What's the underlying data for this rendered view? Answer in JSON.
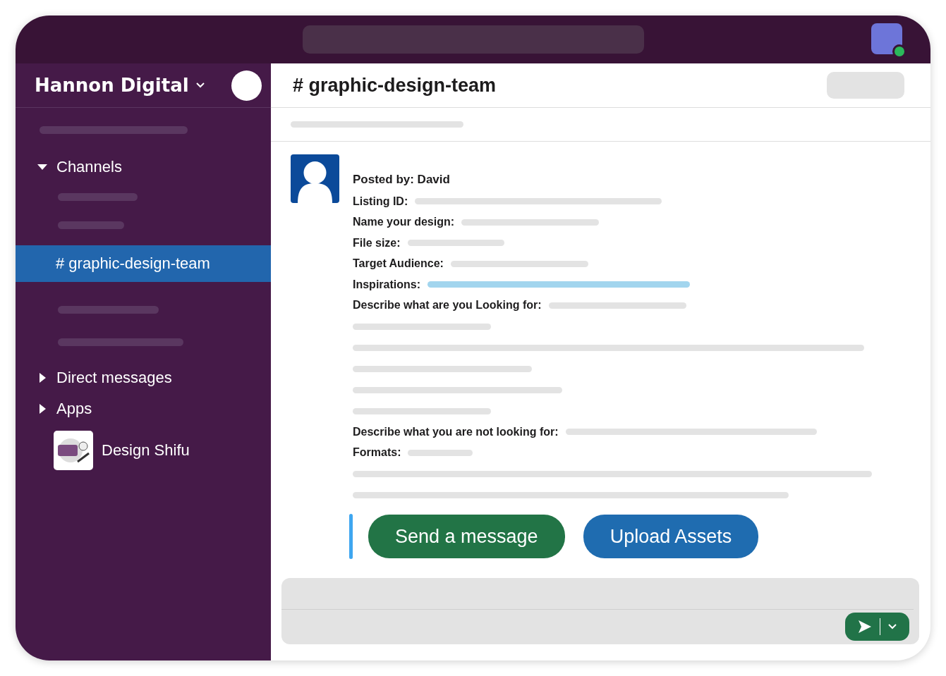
{
  "workspace": {
    "name": "Hannon Digital"
  },
  "sidebar": {
    "sections": [
      {
        "label": "Channels",
        "expanded": true,
        "items": [
          {
            "name": "# graphic-design-team",
            "selected": true
          }
        ]
      },
      {
        "label": "Direct messages",
        "expanded": false
      },
      {
        "label": "Apps",
        "expanded": false
      }
    ],
    "apps": [
      {
        "name": "Design Shifu"
      }
    ]
  },
  "channel": {
    "title": "# graphic-design-team"
  },
  "post": {
    "posted_by": "Posted by: David",
    "fields": [
      {
        "label": "Listing ID:",
        "kind": "text"
      },
      {
        "label": "Name your design:",
        "kind": "text"
      },
      {
        "label": "File size:",
        "kind": "text"
      },
      {
        "label": "Target Audience:",
        "kind": "text"
      },
      {
        "label": "Inspirations:",
        "kind": "link"
      },
      {
        "label": "Describe what are you Looking for:",
        "kind": "text"
      },
      {
        "label": "Describe what you are not looking for:",
        "kind": "text"
      },
      {
        "label": "Formats:",
        "kind": "text"
      }
    ],
    "buttons": [
      {
        "label": "Send a message",
        "kind": "primary"
      },
      {
        "label": "Upload Assets",
        "kind": "secondary"
      }
    ]
  }
}
